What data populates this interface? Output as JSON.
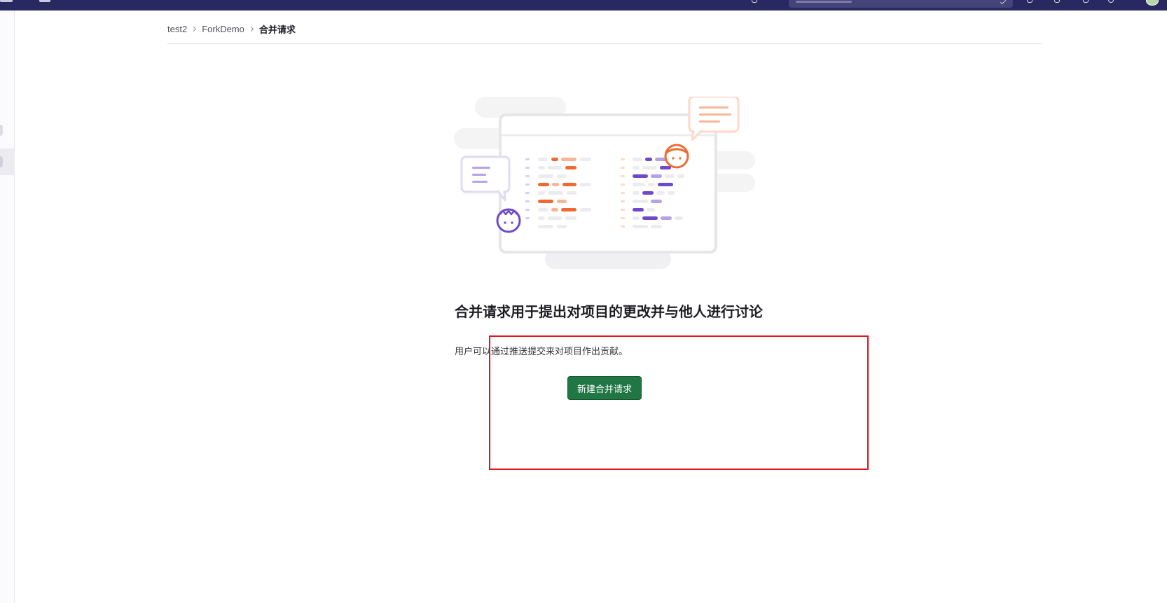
{
  "topbar": {
    "bg_color": "#292961",
    "search_placeholder": "",
    "icons": [
      "todo-icon",
      "merge-request-icon",
      "issues-icon",
      "help-icon",
      "avatar-icon"
    ]
  },
  "breadcrumb": {
    "items": [
      {
        "label": "test2"
      },
      {
        "label": "ForkDemo"
      }
    ],
    "current": "合并请求"
  },
  "empty_state": {
    "title": "合并请求用于提出对项目的更改并与他人进行讨论",
    "description": "用户可以通过推送提交来对项目作出贡献。",
    "button_label": "新建合并请求",
    "button_color": "#217645"
  },
  "colors": {
    "accent_orange": "#ef6a31",
    "accent_purple": "#6e49cb",
    "annotation_red": "#e3141b"
  }
}
